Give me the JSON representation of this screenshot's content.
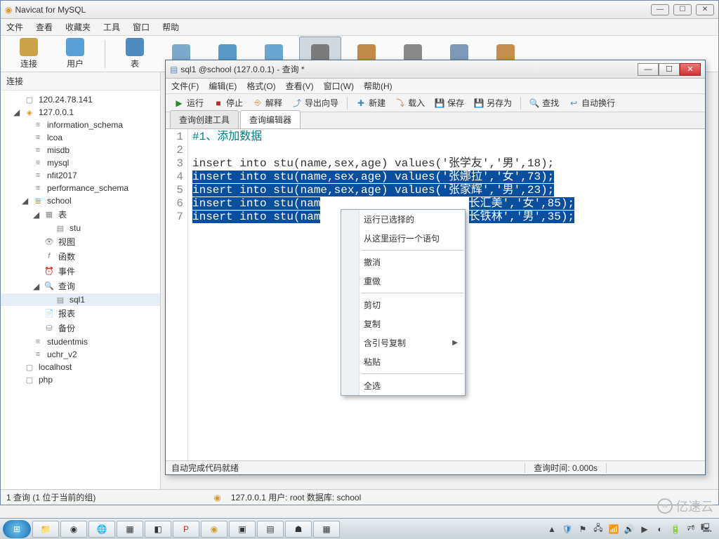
{
  "outer": {
    "title": "Navicat for MySQL",
    "menu": [
      "文件",
      "查看",
      "收藏夹",
      "工具",
      "窗口",
      "帮助"
    ],
    "toolbar": [
      {
        "label": "连接",
        "icon": "plug",
        "color": "#c9a24a"
      },
      {
        "label": "用户",
        "icon": "user",
        "color": "#5aa0d8"
      },
      {
        "label": "表",
        "icon": "table",
        "color": "#4f8bbf"
      },
      {
        "label": "",
        "icon": "view",
        "color": "#7aa9cc"
      },
      {
        "label": "",
        "icon": "func",
        "color": "#5a99c8"
      },
      {
        "label": "",
        "icon": "event",
        "color": "#6aa6d0"
      },
      {
        "label": "",
        "icon": "query",
        "color": "#7b7b7b",
        "selected": true
      },
      {
        "label": "",
        "icon": "report",
        "color": "#c08a4b"
      },
      {
        "label": "",
        "icon": "backup",
        "color": "#8a8a8a"
      },
      {
        "label": "",
        "icon": "schedule",
        "color": "#7d99b8"
      },
      {
        "label": "",
        "icon": "model",
        "color": "#c58f4f"
      }
    ],
    "sidebar_title": "连接",
    "status_left": "1 查询 (1 位于当前的组)",
    "status_right": "127.0.0.1    用户: root    数据库: school"
  },
  "tree": [
    {
      "lvl": 0,
      "icon": "server-off",
      "label": "120.24.78.141"
    },
    {
      "lvl": 0,
      "icon": "server-on",
      "label": "127.0.0.1",
      "open": true
    },
    {
      "lvl": 1,
      "icon": "db",
      "label": "information_schema"
    },
    {
      "lvl": 1,
      "icon": "db",
      "label": "lcoa"
    },
    {
      "lvl": 1,
      "icon": "db",
      "label": "misdb"
    },
    {
      "lvl": 1,
      "icon": "db",
      "label": "mysql"
    },
    {
      "lvl": 1,
      "icon": "db",
      "label": "nfit2017"
    },
    {
      "lvl": 1,
      "icon": "db",
      "label": "performance_schema"
    },
    {
      "lvl": 1,
      "icon": "db-open",
      "label": "school",
      "open": true
    },
    {
      "lvl": 2,
      "icon": "tables",
      "label": "表",
      "open": true
    },
    {
      "lvl": 3,
      "icon": "table",
      "label": "stu"
    },
    {
      "lvl": 2,
      "icon": "view",
      "label": "视图"
    },
    {
      "lvl": 2,
      "icon": "func",
      "label": "函数"
    },
    {
      "lvl": 2,
      "icon": "event",
      "label": "事件"
    },
    {
      "lvl": 2,
      "icon": "query-folder",
      "label": "查询",
      "open": true
    },
    {
      "lvl": 3,
      "icon": "query",
      "label": "sql1",
      "selected": true
    },
    {
      "lvl": 2,
      "icon": "report",
      "label": "报表"
    },
    {
      "lvl": 2,
      "icon": "backup",
      "label": "备份"
    },
    {
      "lvl": 1,
      "icon": "db",
      "label": "studentmis"
    },
    {
      "lvl": 1,
      "icon": "db",
      "label": "uchr_v2"
    },
    {
      "lvl": 0,
      "icon": "server-off",
      "label": "localhost"
    },
    {
      "lvl": 0,
      "icon": "server-off",
      "label": "php"
    }
  ],
  "inner": {
    "title": "sql1 @school (127.0.0.1) - 查询 *",
    "menu": [
      "文件(F)",
      "编辑(E)",
      "格式(O)",
      "查看(V)",
      "窗口(W)",
      "帮助(H)"
    ],
    "toolbar": [
      {
        "label": "运行",
        "icon": "▶",
        "color": "#2a8a2a"
      },
      {
        "label": "停止",
        "icon": "■",
        "color": "#b03030"
      },
      {
        "label": "解释",
        "icon": "⎆",
        "color": "#c28a3a"
      },
      {
        "label": "导出向导",
        "icon": "⤴",
        "color": "#5a8ac0"
      },
      {
        "label": "新建",
        "icon": "✚",
        "color": "#4a8ac0",
        "sep": true
      },
      {
        "label": "载入",
        "icon": "⤵",
        "color": "#c08a4a"
      },
      {
        "label": "保存",
        "icon": "💾",
        "color": "#4a6a9a"
      },
      {
        "label": "另存为",
        "icon": "💾",
        "color": "#4a6a9a"
      },
      {
        "label": "查找",
        "icon": "🔍",
        "color": "#777",
        "sep": true
      },
      {
        "label": "自动换行",
        "icon": "↩",
        "color": "#5a8ac0"
      }
    ],
    "tabs": [
      {
        "label": "查询创建工具",
        "active": false
      },
      {
        "label": "查询编辑器",
        "active": true
      }
    ],
    "status_left": "自动完成代码就绪",
    "status_right": "查询时间: 0.000s"
  },
  "editor": {
    "lines": [
      {
        "n": 1,
        "type": "comment",
        "text": "#1、添加数据"
      },
      {
        "n": 2,
        "type": "blank",
        "text": ""
      },
      {
        "n": 3,
        "type": "code",
        "text": "insert into stu(name,sex,age) values('张学友','男',18);"
      },
      {
        "n": 4,
        "type": "sel",
        "text": "insert into stu(name,sex,age) values('张娜拉','女',73);"
      },
      {
        "n": 5,
        "type": "sel",
        "text": "insert into stu(name,sex,age) values('张家辉','男',23);"
      },
      {
        "n": 6,
        "type": "selcut",
        "pre": "insert into stu(nam",
        "post": "长汇美','女',85);"
      },
      {
        "n": 7,
        "type": "selcut",
        "pre": "insert into stu(nam",
        "post": "长铁林','男',35);"
      }
    ]
  },
  "context_menu": [
    {
      "label": "运行已选择的"
    },
    {
      "label": "从这里运行一个语句"
    },
    {
      "sep": true
    },
    {
      "label": "撤消"
    },
    {
      "label": "重做"
    },
    {
      "sep": true
    },
    {
      "label": "剪切"
    },
    {
      "label": "复制"
    },
    {
      "label": "含引号复制",
      "submenu": true
    },
    {
      "label": "粘贴"
    },
    {
      "sep": true
    },
    {
      "label": "全选"
    }
  ],
  "watermark": "亿速云"
}
